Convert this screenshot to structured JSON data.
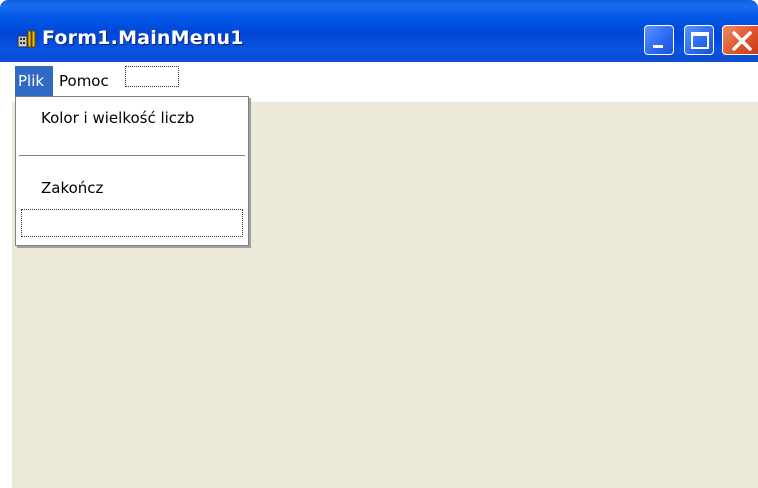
{
  "window": {
    "title": "Form1.MainMenu1",
    "controls": [
      "minimize",
      "maximize",
      "close"
    ],
    "icon": "app-icon"
  },
  "menubar": {
    "items": [
      {
        "label": "Plik",
        "selected": true
      },
      {
        "label": "Pomoc",
        "selected": false
      }
    ],
    "has_placeholder_slot": true
  },
  "dropdown": {
    "items": [
      {
        "label": "Kolor i wielkość liczb"
      },
      {
        "type": "separator"
      },
      {
        "label": "Zakończ"
      }
    ],
    "has_placeholder_slot": true
  },
  "colors": {
    "titlebar": "#0055e5",
    "client_background": "#ece9d8",
    "menu_highlight": "#316ac5",
    "close_button": "#e0542c"
  }
}
